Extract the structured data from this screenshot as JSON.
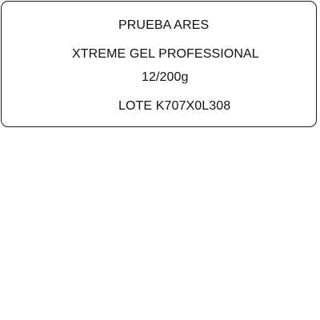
{
  "label": {
    "brand": "PRUEBA ARES",
    "product_name": "XTREME GEL PROFESSIONAL",
    "package": "12/200g",
    "lot": "LOTE K707X0L308"
  }
}
